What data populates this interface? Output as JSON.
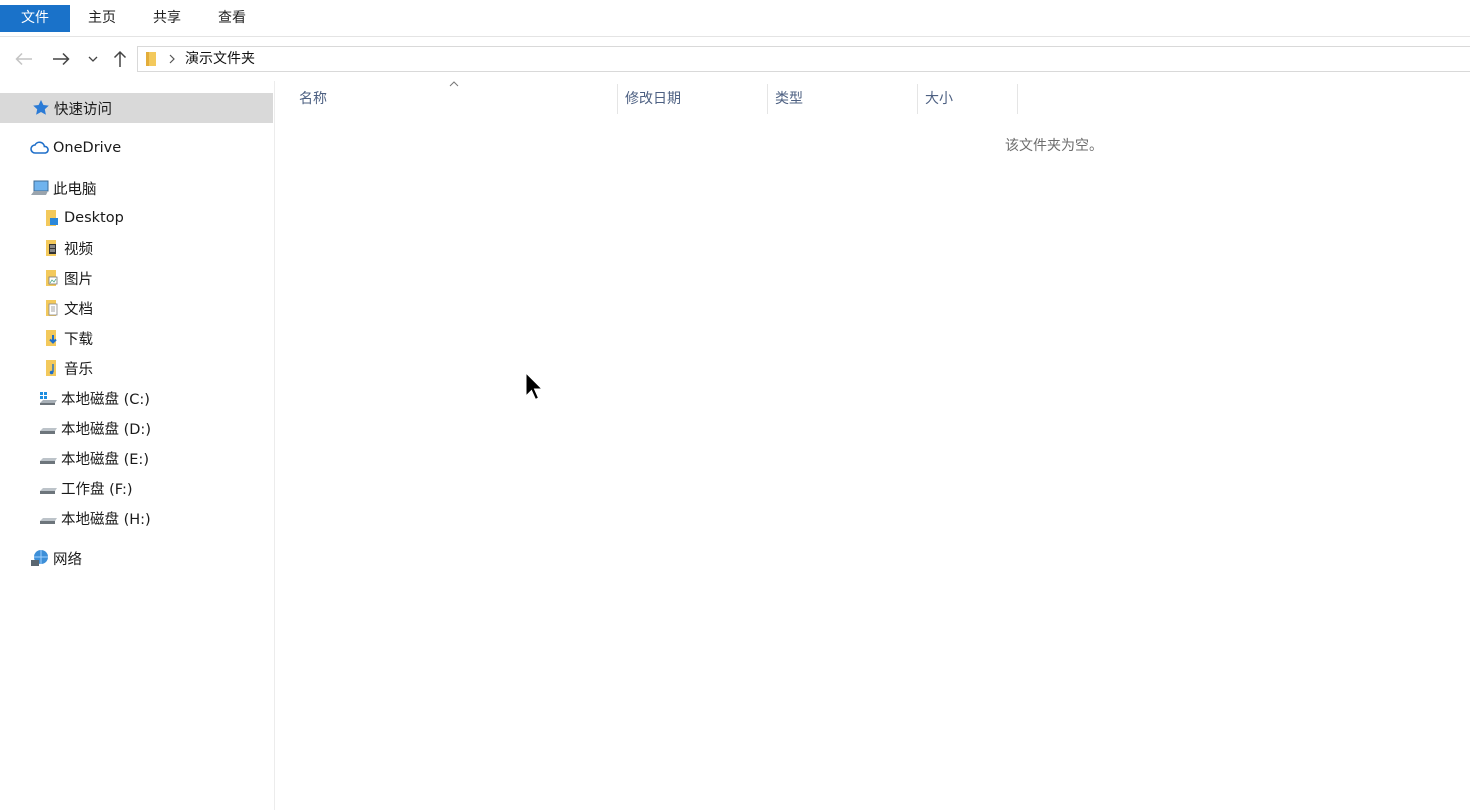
{
  "ribbon": {
    "file_tab": "文件",
    "tabs": [
      "主页",
      "共享",
      "查看"
    ]
  },
  "address": {
    "path": "演示文件夹"
  },
  "sidebar": {
    "quick_access": "快速访问",
    "onedrive": "OneDrive",
    "this_pc": "此电脑",
    "items": [
      "Desktop",
      "视频",
      "图片",
      "文档",
      "下载",
      "音乐",
      "本地磁盘 (C:)",
      "本地磁盘 (D:)",
      "本地磁盘 (E:)",
      "工作盘 (F:)",
      "本地磁盘 (H:)"
    ],
    "network": "网络"
  },
  "columns": {
    "name": "名称",
    "date": "修改日期",
    "type": "类型",
    "size": "大小"
  },
  "empty_message": "该文件夹为空。",
  "colors": {
    "accent": "#1a72c9",
    "selected_bg": "#d9d9d9",
    "column_header_text": "#4d6082"
  }
}
